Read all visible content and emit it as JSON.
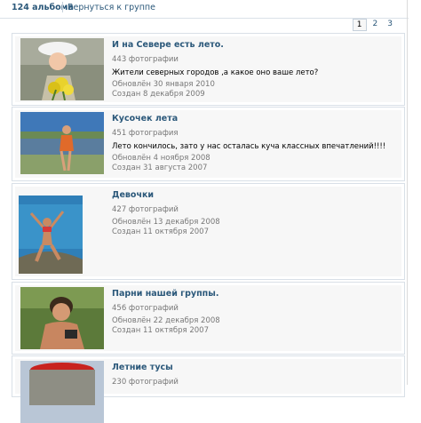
{
  "header": {
    "album_count": "124 альбома",
    "back_link": "Вернуться к группе"
  },
  "pagination": [
    "1",
    "2",
    "3"
  ],
  "albums": [
    {
      "title": "И на Севере есть лето.",
      "photos": "443 фотографии",
      "description": "Жители северных городов ,а какое оно ваше лето?",
      "updated": "Обновлён 30 января 2010",
      "created": "Создан 8 декабря 2009"
    },
    {
      "title": "Кусочек лета",
      "photos": "451 фотография",
      "description": "Лето кончилось, зато у нас осталась куча классных впечатлений!!!!",
      "updated": "Обновлён 4 ноября 2008",
      "created": "Создан 31 августа 2007"
    },
    {
      "title": "Девочки",
      "photos": "427 фотографий",
      "description": "",
      "updated": "Обновлён 13 декабря 2008",
      "created": "Создан 11 октября 2007"
    },
    {
      "title": "Парни нашей группы.",
      "photos": "456 фотографий",
      "description": "",
      "updated": "Обновлён 22 декабря 2008",
      "created": "Создан 11 октября 2007"
    },
    {
      "title": "Летние тусы",
      "photos": "230 фотографий",
      "description": "",
      "updated": "",
      "created": ""
    }
  ]
}
